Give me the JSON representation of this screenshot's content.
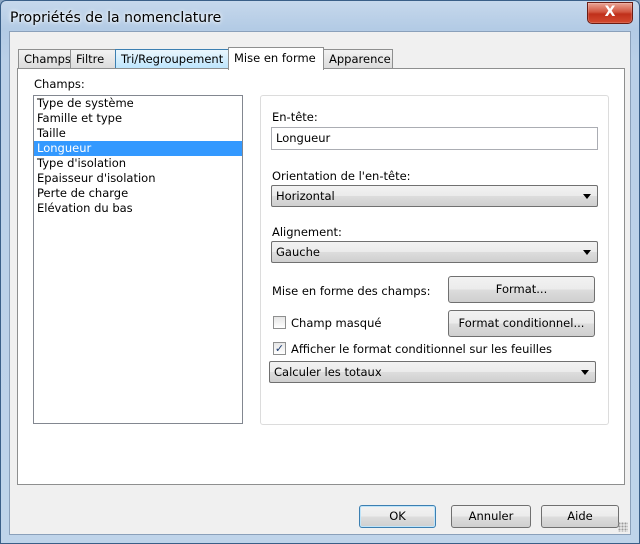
{
  "window": {
    "title": "Propriétés de la nomenclature",
    "close_glyph": "X"
  },
  "tabs": [
    {
      "label": "Champs"
    },
    {
      "label": "Filtre"
    },
    {
      "label": "Tri/Regroupement"
    },
    {
      "label": "Mise en forme",
      "selected": true
    },
    {
      "label": "Apparence"
    }
  ],
  "fields": {
    "label": "Champs:",
    "items": [
      "Type de système",
      "Famille et type",
      "Taille",
      "Longueur",
      "Type d'isolation",
      "Epaisseur d'isolation",
      "Perte de charge",
      "Elévation du bas"
    ],
    "selected_index": 3
  },
  "format": {
    "header_label": "En-tête:",
    "header_value": "Longueur",
    "orientation_label": "Orientation de l'en-tête:",
    "orientation_value": "Horizontal",
    "alignment_label": "Alignement:",
    "alignment_value": "Gauche",
    "field_format_label": "Mise en forme des champs:",
    "format_button": "Format...",
    "hidden_field_label": "Champ masqué",
    "hidden_field_checked": false,
    "conditional_format_button": "Format conditionnel...",
    "show_conditional_label": "Afficher le format conditionnel sur les feuilles",
    "show_conditional_checked": true,
    "totals_value": "Calculer les totaux",
    "checkmark_glyph": "✓"
  },
  "buttons": {
    "ok": "OK",
    "cancel": "Annuler",
    "help": "Aide"
  },
  "colors": {
    "selection": "#3399ff",
    "close_button": "#c0301b"
  }
}
